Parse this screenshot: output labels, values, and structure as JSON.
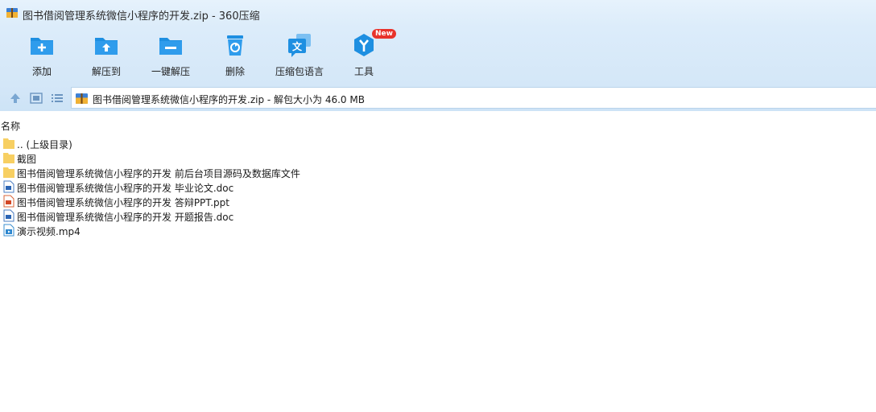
{
  "window": {
    "title": "图书借阅管理系统微信小程序的开发.zip - 360压缩"
  },
  "toolbar": {
    "items": [
      {
        "label": "添加",
        "icon": "add-folder-icon"
      },
      {
        "label": "解压到",
        "icon": "extract-to-icon"
      },
      {
        "label": "一键解压",
        "icon": "one-click-extract-icon"
      },
      {
        "label": "删除",
        "icon": "recycle-bin-icon"
      },
      {
        "label": "压缩包语言",
        "icon": "language-icon"
      },
      {
        "label": "工具",
        "icon": "tools-icon",
        "badge": "New"
      }
    ]
  },
  "address": {
    "text": "图书借阅管理系统微信小程序的开发.zip - 解包大小为 46.0 MB"
  },
  "list": {
    "column_name": "名称",
    "rows": [
      {
        "name": ".. (上级目录)",
        "type": "folder"
      },
      {
        "name": "截图",
        "type": "folder"
      },
      {
        "name": "图书借阅管理系统微信小程序的开发 前后台项目源码及数据库文件",
        "type": "folder"
      },
      {
        "name": "图书借阅管理系统微信小程序的开发 毕业论文.doc",
        "type": "doc"
      },
      {
        "name": "图书借阅管理系统微信小程序的开发 答辩PPT.ppt",
        "type": "ppt"
      },
      {
        "name": "图书借阅管理系统微信小程序的开发 开题报告.doc",
        "type": "doc"
      },
      {
        "name": "演示视频.mp4",
        "type": "video"
      }
    ]
  },
  "colors": {
    "accent": "#1e8fe1",
    "badge": "#e8332b",
    "folder": "#f7cf62"
  }
}
